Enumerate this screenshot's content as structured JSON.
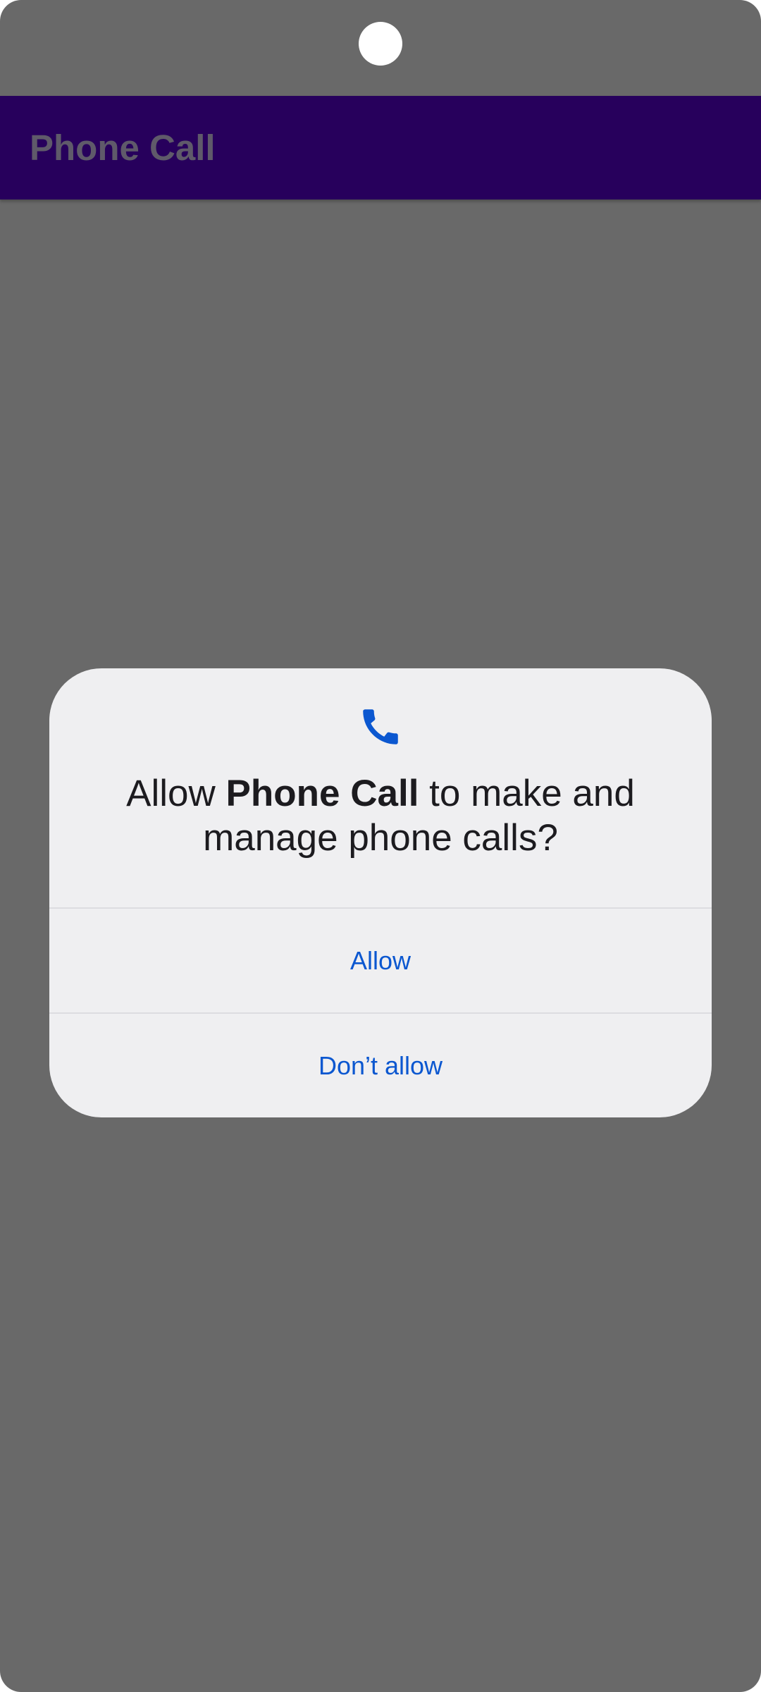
{
  "app_bar": {
    "title": "Phone Call"
  },
  "permission_dialog": {
    "icon": "phone-icon",
    "message_prefix": "Allow ",
    "app_name": "Phone Call",
    "message_suffix": " to make and manage phone calls?",
    "allow_label": "Allow",
    "deny_label": "Don’t allow"
  },
  "colors": {
    "accent": "#0b57d0",
    "app_bar": "#27005c",
    "scrim_background": "#696969",
    "dialog_background": "#efeff1"
  }
}
